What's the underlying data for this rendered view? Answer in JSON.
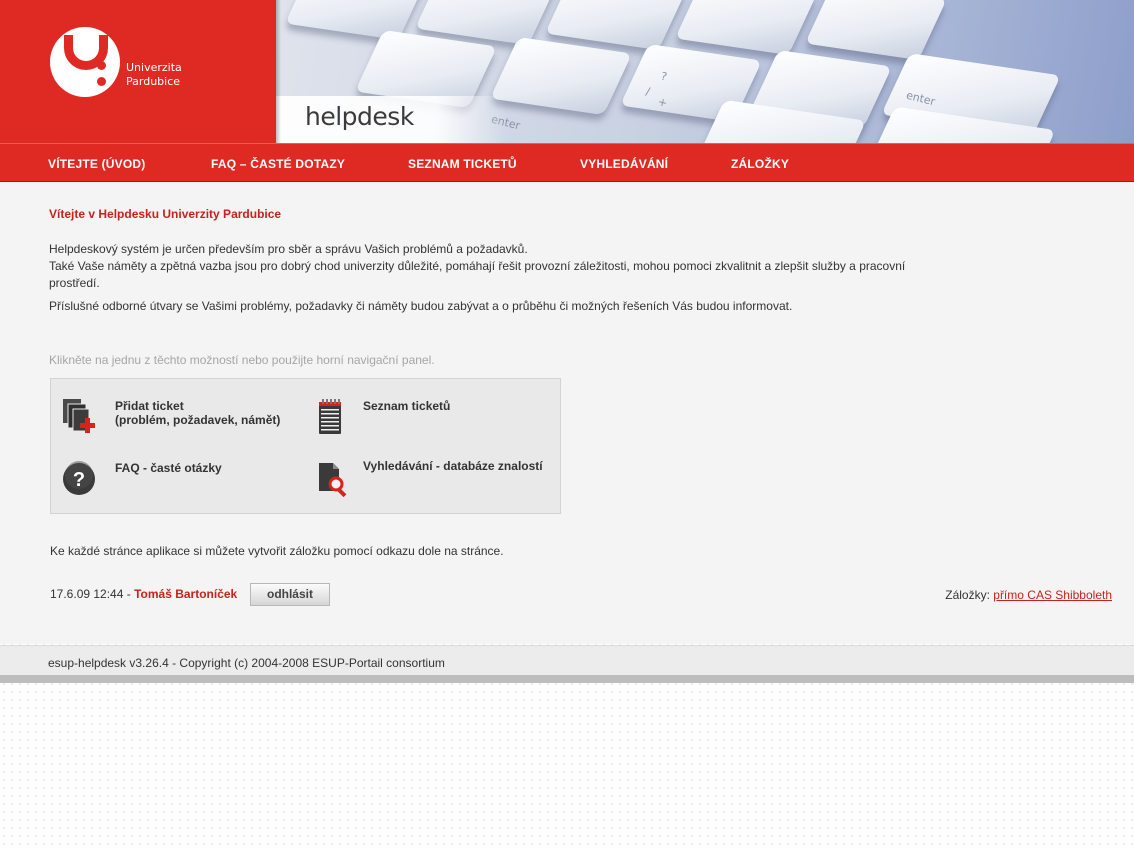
{
  "header": {
    "logo_line1": "Univerzita",
    "logo_line2": "Pardubice",
    "app_title": "helpdesk",
    "key_labels": [
      "enter",
      "enter",
      "?",
      "/",
      "+"
    ]
  },
  "nav": {
    "items": [
      {
        "label": "VÍTEJTE (ÚVOD)"
      },
      {
        "label": "FAQ – ČASTÉ DOTAZY"
      },
      {
        "label": "SEZNAM TICKETŮ"
      },
      {
        "label": "VYHLEDÁVÁNÍ"
      },
      {
        "label": "ZÁLOŽKY"
      }
    ]
  },
  "main": {
    "title": "Vítejte v Helpdesku Univerzity Pardubice",
    "intro_p1_line1": "Helpdeskový systém je určen především pro sběr a správu Vašich problémů a požadavků.",
    "intro_p1_line2": "Také Vaše náměty a zpětná vazba jsou pro dobrý chod univerzity důležité, pomáhají řešit provozní záležitosti, mohou pomoci zkvalitnit a zlepšit služby a pracovní prostředí.",
    "intro_p2": "Příslušné odborné útvary se Vašimi problémy, požadavky či náměty budou zabývat a o průběhu či možných řešeních Vás budou informovat.",
    "hint": "Klikněte na jednu z těchto možností nebo použijte horní navigační panel.",
    "options": {
      "add_ticket_line1": "Přidat ticket",
      "add_ticket_line2": "(problém, požadavek, námět)",
      "ticket_list": "Seznam ticketů",
      "faq": "FAQ - časté otázky",
      "search": "Vyhledávání - databáze znalostí"
    },
    "notice": "Ke každé stránce aplikace si můžete vytvořit záložku pomocí odkazu dole na stránce.",
    "status_datetime": "17.6.09 12:44",
    "status_separator": " - ",
    "user_name": "Tomáš Bartoníček",
    "logout_label": "odhlásit",
    "bookmarks_label": "Záložky:",
    "bookmarks_link": "přímo CAS Shibboleth"
  },
  "footer": {
    "text": "esup-helpdesk v3.26.4 - Copyright (c) 2004-2008 ESUP-Portail consortium"
  },
  "colors": {
    "brand_red": "#df2a24",
    "link_red": "#c8221d"
  }
}
